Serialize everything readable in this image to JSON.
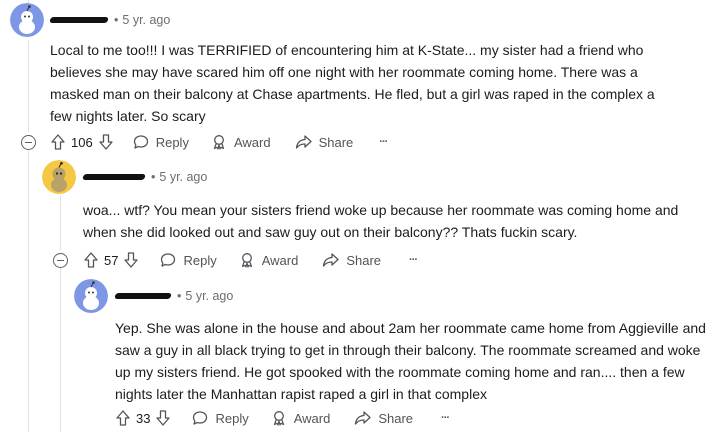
{
  "comments": [
    {
      "time": "5 yr. ago",
      "separator": "•",
      "text": "Local to me too!!! I was TERRIFIED of encountering him at K-State... my sister had a friend who believes she may have scared him off one night with her roommate coming home. There was a masked man on their balcony at Chase apartments. He fled, but a girl was raped in the complex a few nights later. So scary",
      "votes": "106",
      "avatar_color": "#7e96e6"
    },
    {
      "time": "5 yr. ago",
      "separator": "•",
      "text": "woa... wtf? You mean your sisters friend woke up because her roommate was coming home and when she did looked out and saw guy out on their balcony?? Thats fuckin scary.",
      "votes": "57",
      "avatar_color": "#f4c842"
    },
    {
      "time": "5 yr. ago",
      "separator": "•",
      "text": "Yep. She was alone in the house and about 2am her roommate came home from Aggieville and saw a guy in all black trying to get in through their balcony. The roommate screamed and woke up my sisters friend. He got spooked with the roommate coming home and ran.... then a few nights later the Manhattan rapist raped a girl in that complex",
      "votes": "33",
      "avatar_color": "#7e96e6"
    }
  ],
  "actions": {
    "reply": "Reply",
    "award": "Award",
    "share": "Share",
    "more": "···"
  },
  "icons": [
    "upvote-icon",
    "downvote-icon",
    "reply-icon",
    "award-icon",
    "share-icon",
    "more-icon",
    "collapse-icon",
    "avatar-icon"
  ]
}
